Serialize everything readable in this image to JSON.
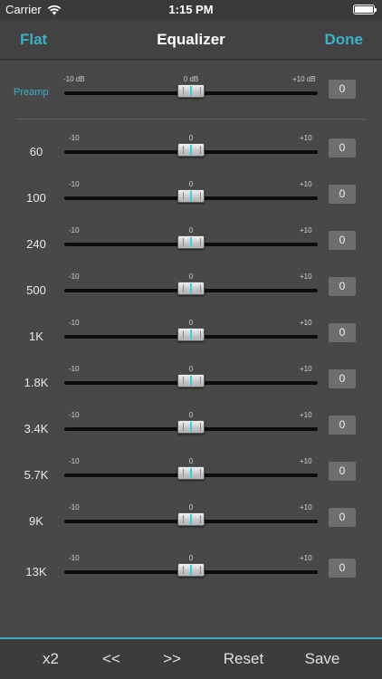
{
  "status": {
    "carrier": "Carrier",
    "time": "1:15 PM"
  },
  "nav": {
    "left": "Flat",
    "title": "Equalizer",
    "right": "Done"
  },
  "preamp": {
    "label": "Preamp",
    "min": "-10 dB",
    "mid": "0 dB",
    "max": "+10 dB",
    "value": "0",
    "level": 0
  },
  "bands": [
    {
      "label": "60",
      "min": "-10",
      "mid": "0",
      "max": "+10",
      "value": "0",
      "level": 0
    },
    {
      "label": "100",
      "min": "-10",
      "mid": "0",
      "max": "+10",
      "value": "0",
      "level": 0
    },
    {
      "label": "240",
      "min": "-10",
      "mid": "0",
      "max": "+10",
      "value": "0",
      "level": 0
    },
    {
      "label": "500",
      "min": "-10",
      "mid": "0",
      "max": "+10",
      "value": "0",
      "level": 0
    },
    {
      "label": "1K",
      "min": "-10",
      "mid": "0",
      "max": "+10",
      "value": "0",
      "level": 0
    },
    {
      "label": "1.8K",
      "min": "-10",
      "mid": "0",
      "max": "+10",
      "value": "0",
      "level": 0
    },
    {
      "label": "3.4K",
      "min": "-10",
      "mid": "0",
      "max": "+10",
      "value": "0",
      "level": 0
    },
    {
      "label": "5.7K",
      "min": "-10",
      "mid": "0",
      "max": "+10",
      "value": "0",
      "level": 0
    },
    {
      "label": "9K",
      "min": "-10",
      "mid": "0",
      "max": "+10",
      "value": "0",
      "level": 0
    },
    {
      "label": "13K",
      "min": "-10",
      "mid": "0",
      "max": "+10",
      "value": "0",
      "level": 0
    }
  ],
  "toolbar": {
    "double": "x2",
    "prev": "<<",
    "next": ">>",
    "reset": "Reset",
    "save": "Save"
  },
  "colors": {
    "accent": "#3ab0c8",
    "knob_mark": "#2fd3e6",
    "background": "#484848"
  }
}
